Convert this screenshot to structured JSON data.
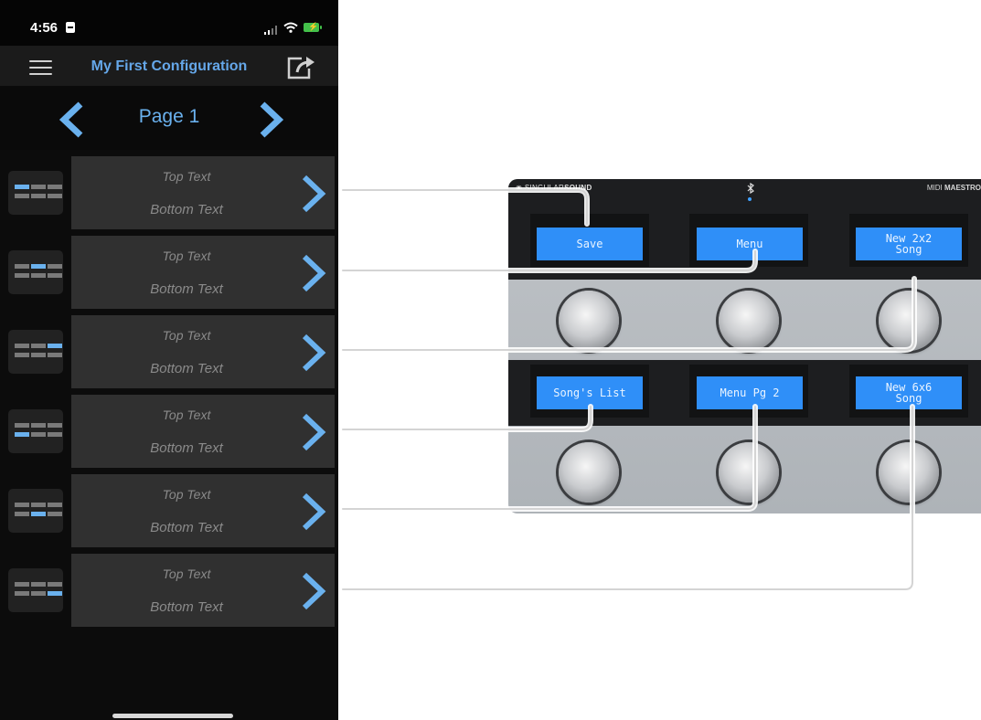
{
  "status_bar": {
    "time": "4:56",
    "battery_symbol": "⚡"
  },
  "nav": {
    "title": "My First Configuration"
  },
  "pager": {
    "label": "Page 1"
  },
  "rows": [
    {
      "top_text": "Top Text",
      "bottom_text": "Bottom Text"
    },
    {
      "top_text": "Top Text",
      "bottom_text": "Bottom Text"
    },
    {
      "top_text": "Top Text",
      "bottom_text": "Bottom Text"
    },
    {
      "top_text": "Top Text",
      "bottom_text": "Bottom Text"
    },
    {
      "top_text": "Top Text",
      "bottom_text": "Bottom Text"
    },
    {
      "top_text": "Top Text",
      "bottom_text": "Bottom Text"
    }
  ],
  "device": {
    "brand_prefix": "SINGULAR",
    "brand_suffix": "SOUND",
    "model_prefix": "MIDI",
    "model_suffix": "MAESTRO",
    "screens": [
      "Save",
      "Menu",
      "New 2x2\nSong",
      "Song's List",
      "Menu Pg 2",
      "New 6x6\nSong"
    ]
  },
  "colors": {
    "accent": "#6ab1ee",
    "lcd": "#2f8ff8",
    "card": "#303030",
    "battery": "#43c04a"
  }
}
